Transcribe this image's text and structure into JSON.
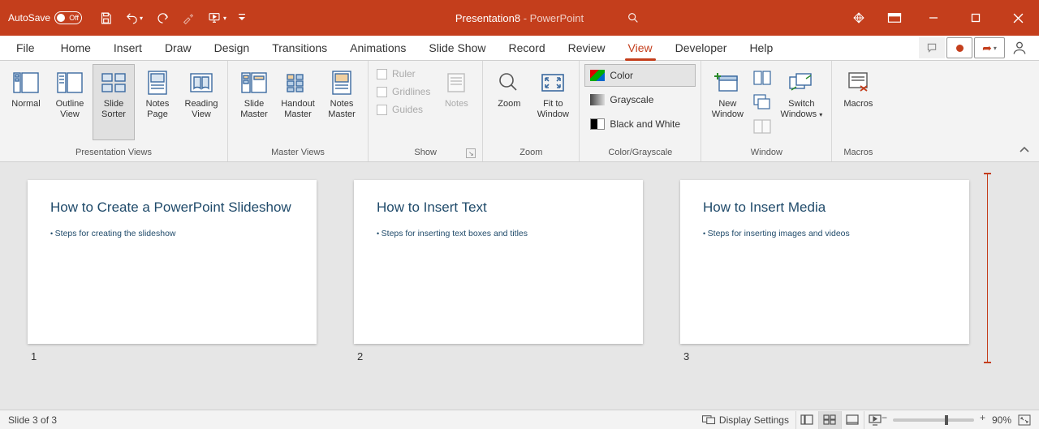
{
  "title": {
    "filename": "Presentation8",
    "app": " -  PowerPoint"
  },
  "qat": {
    "autosave_label": "AutoSave",
    "toggle_state": "Off"
  },
  "tabs": {
    "file": "File",
    "list": [
      "Home",
      "Insert",
      "Draw",
      "Design",
      "Transitions",
      "Animations",
      "Slide Show",
      "Record",
      "Review",
      "View",
      "Developer",
      "Help"
    ],
    "active": "View"
  },
  "ribbon": {
    "presentation_views": {
      "label": "Presentation Views",
      "normal": "Normal",
      "outline": "Outline\nView",
      "sorter": "Slide\nSorter",
      "notes": "Notes\nPage",
      "reading": "Reading\nView"
    },
    "master_views": {
      "label": "Master Views",
      "slide": "Slide\nMaster",
      "handout": "Handout\nMaster",
      "notes": "Notes\nMaster"
    },
    "show": {
      "label": "Show",
      "ruler": "Ruler",
      "gridlines": "Gridlines",
      "guides": "Guides",
      "notes": "Notes"
    },
    "zoom_group": {
      "label": "Zoom",
      "zoom": "Zoom",
      "fit": "Fit to\nWindow"
    },
    "color_group": {
      "label": "Color/Grayscale",
      "color": "Color",
      "gray": "Grayscale",
      "bw": "Black and White"
    },
    "window_group": {
      "label": "Window",
      "new": "New\nWindow",
      "switch": "Switch\nWindows"
    },
    "macros_group": {
      "label": "Macros",
      "macros": "Macros"
    }
  },
  "slides": [
    {
      "num": "1",
      "title": "How to Create a PowerPoint Slideshow",
      "bullet": "Steps for creating the slideshow"
    },
    {
      "num": "2",
      "title": "How to Insert Text",
      "bullet": "Steps for inserting text boxes and titles"
    },
    {
      "num": "3",
      "title": "How to Insert Media",
      "bullet": "Steps for inserting images and videos"
    }
  ],
  "status": {
    "left": "Slide 3 of 3",
    "display_settings": "Display Settings",
    "zoom": "90%"
  }
}
